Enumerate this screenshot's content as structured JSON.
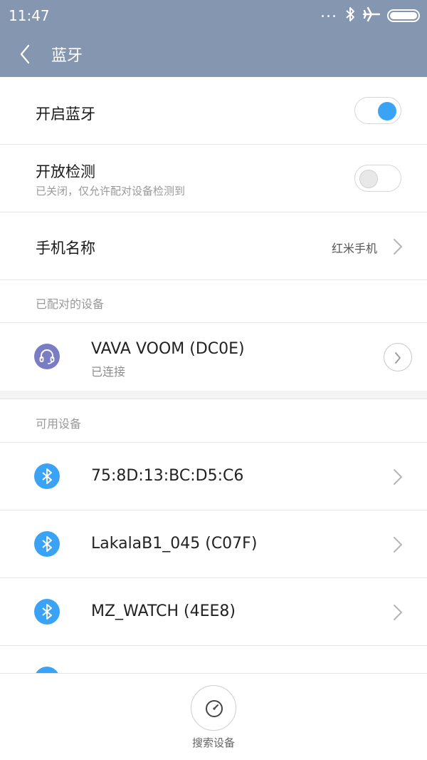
{
  "status_bar": {
    "time": "11:47",
    "dots": "...",
    "icons": [
      "bluetooth-icon",
      "airplane-icon",
      "battery-icon"
    ],
    "battery_level": 1.0
  },
  "header": {
    "title": "蓝牙",
    "background": "#8596b0"
  },
  "settings": {
    "bluetooth": {
      "label": "开启蓝牙",
      "enabled": true
    },
    "discoverable": {
      "label": "开放检测",
      "subtitle": "已关闭，仅允许配对设备检测到",
      "enabled": false
    },
    "phone_name": {
      "label": "手机名称",
      "value": "红米手机"
    }
  },
  "paired": {
    "header": "已配对的设备",
    "devices": [
      {
        "name": "VAVA VOOM (DC0E)",
        "status": "已连接",
        "icon": "headset-icon",
        "icon_color": "#7a7cc4"
      }
    ]
  },
  "available": {
    "header": "可用设备",
    "devices": [
      {
        "name": "75:8D:13:BC:D5:C6",
        "icon": "bluetooth-icon"
      },
      {
        "name": "LakalaB1_045 (C07F)",
        "icon": "bluetooth-icon"
      },
      {
        "name": "MZ_WATCH (4EE8)",
        "icon": "bluetooth-icon"
      }
    ],
    "icon_color": "#3aa3f5"
  },
  "bottom": {
    "scan_label": "搜索设备",
    "scan_icon": "radar-icon"
  },
  "accent": "#3aa3f5"
}
